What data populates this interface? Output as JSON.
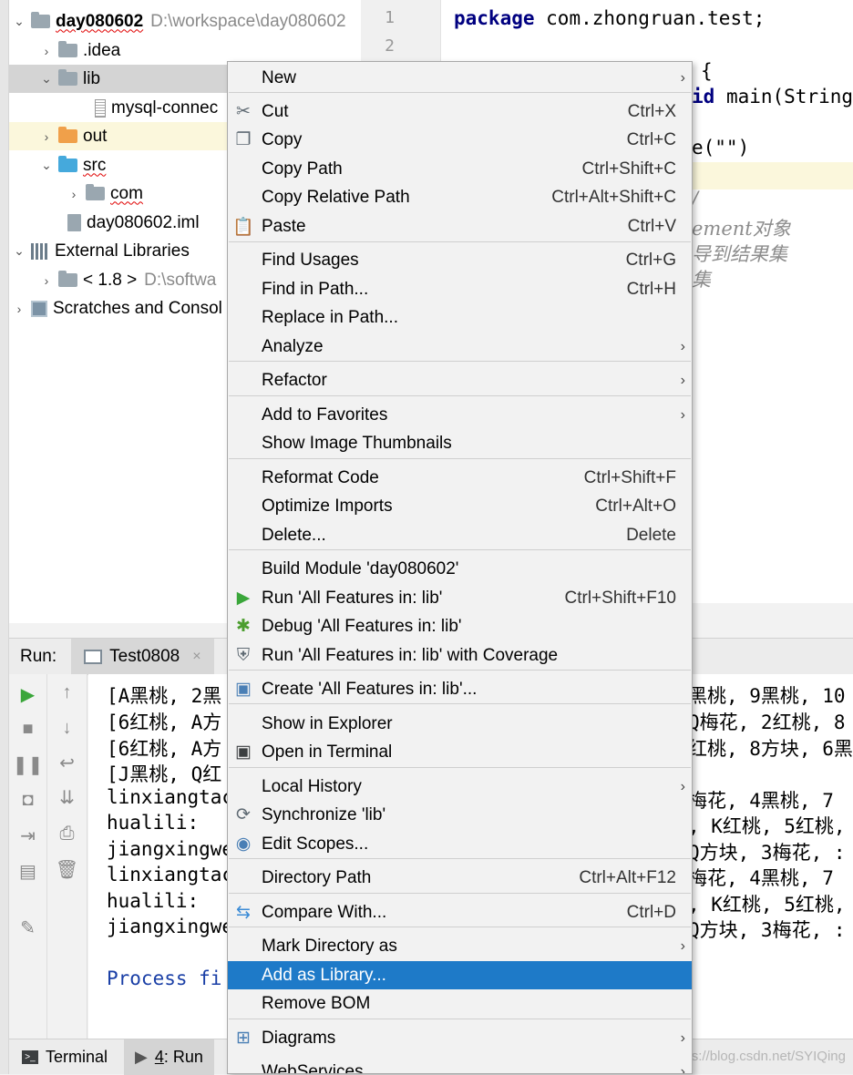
{
  "project": {
    "rows": [
      {
        "name": "day080602",
        "hint": "D:\\workspace\\day080602",
        "expanded": true
      },
      {
        "name": ".idea"
      },
      {
        "name": "lib",
        "expanded": true
      },
      {
        "name": "mysql-connec"
      },
      {
        "name": "out"
      },
      {
        "name": "src",
        "expanded": true
      },
      {
        "name": "com"
      },
      {
        "name": "day080602.iml"
      },
      {
        "name": "External Libraries",
        "expanded": true
      },
      {
        "name": "< 1.8 >",
        "hint": "D:\\softwa"
      },
      {
        "name": "Scratches and Consol"
      }
    ]
  },
  "editor": {
    "line_numbers": [
      "1",
      "2"
    ],
    "lines": [
      {
        "kw": "package",
        "text": " com.zhongruan.test;"
      },
      {
        "text": "{"
      },
      {
        "kw": "id",
        "text": " main(String"
      },
      {
        "text": "e(\"\")"
      },
      {
        "comment": "/"
      },
      {
        "comment": "ement对象"
      },
      {
        "comment": "导到结果集"
      },
      {
        "comment": "集"
      }
    ]
  },
  "run": {
    "label": "Run:",
    "tab": "Test0808",
    "close": "×",
    "console_left": [
      "[A黑桃, 2黑",
      "[6红桃, A方",
      "[6红桃, A方",
      "[J黑桃, Q红",
      "linxiangtac",
      "hualili:",
      "jiangxingwe",
      "linxiangtac",
      "hualili:",
      "jiangxingwe",
      "",
      "Process fi"
    ],
    "console_right": [
      "黑桃, 9黑桃, 10",
      "Q梅花, 2红桃, 8",
      "红桃, 8方块, 6黑",
      "",
      "梅花, 4黑桃, 7",
      ", K红桃, 5红桃,",
      "Q方块, 3梅花, :",
      "梅花, 4黑桃, 7",
      ", K红桃, 5红桃,",
      "Q方块, 3梅花, :"
    ]
  },
  "bottom_bar": {
    "terminal": "Terminal",
    "run_num": "4",
    "run_rest": ": Run",
    "watermark": "https://blog.csdn.net/SYIQing"
  },
  "menu": {
    "items": [
      {
        "label": "New",
        "arrow": true
      },
      {
        "label": "Cut",
        "shortcut": "Ctrl+X",
        "icon": "scissors-icon"
      },
      {
        "label": "Copy",
        "shortcut": "Ctrl+C",
        "icon": "copy-icon"
      },
      {
        "label": "Copy Path",
        "shortcut": "Ctrl+Shift+C"
      },
      {
        "label": "Copy Relative Path",
        "shortcut": "Ctrl+Alt+Shift+C"
      },
      {
        "label": "Paste",
        "shortcut": "Ctrl+V",
        "icon": "paste-icon"
      },
      {
        "label": "Find Usages",
        "shortcut": "Ctrl+G"
      },
      {
        "label": "Find in Path...",
        "shortcut": "Ctrl+H"
      },
      {
        "label": "Replace in Path..."
      },
      {
        "label": "Analyze",
        "arrow": true
      },
      {
        "label": "Refactor",
        "arrow": true
      },
      {
        "label": "Add to Favorites",
        "arrow": true
      },
      {
        "label": "Show Image Thumbnails"
      },
      {
        "label": "Reformat Code",
        "shortcut": "Ctrl+Shift+F"
      },
      {
        "label": "Optimize Imports",
        "shortcut": "Ctrl+Alt+O"
      },
      {
        "label": "Delete...",
        "shortcut": "Delete"
      },
      {
        "label": "Build Module 'day080602'"
      },
      {
        "label": "Run 'All Features in: lib'",
        "shortcut": "Ctrl+Shift+F10",
        "icon": "run-icon"
      },
      {
        "label": "Debug 'All Features in: lib'",
        "icon": "debug-icon"
      },
      {
        "label": "Run 'All Features in: lib' with Coverage",
        "icon": "coverage-icon"
      },
      {
        "label": "Create 'All Features in: lib'...",
        "icon": "create-config-icon"
      },
      {
        "label": "Show in Explorer"
      },
      {
        "label": "Open in Terminal",
        "icon": "terminal-icon"
      },
      {
        "label": "Local History",
        "arrow": true
      },
      {
        "label": "Synchronize 'lib'",
        "icon": "sync-icon"
      },
      {
        "label": "Edit Scopes...",
        "icon": "scope-icon"
      },
      {
        "label": "Directory Path",
        "shortcut": "Ctrl+Alt+F12"
      },
      {
        "label": "Compare With...",
        "shortcut": "Ctrl+D",
        "icon": "compare-icon"
      },
      {
        "label": "Mark Directory as",
        "arrow": true
      },
      {
        "label": "Add as Library...",
        "active": true
      },
      {
        "label": "Remove BOM"
      },
      {
        "label": "Diagrams",
        "arrow": true,
        "icon": "diagram-icon"
      },
      {
        "label": "WebServices",
        "arrow": true
      }
    ]
  },
  "colors": {
    "accent": "#1e7ac8",
    "run_green": "#3aa63a",
    "debug_green": "#4c9e2f",
    "keyword": "#000080"
  }
}
